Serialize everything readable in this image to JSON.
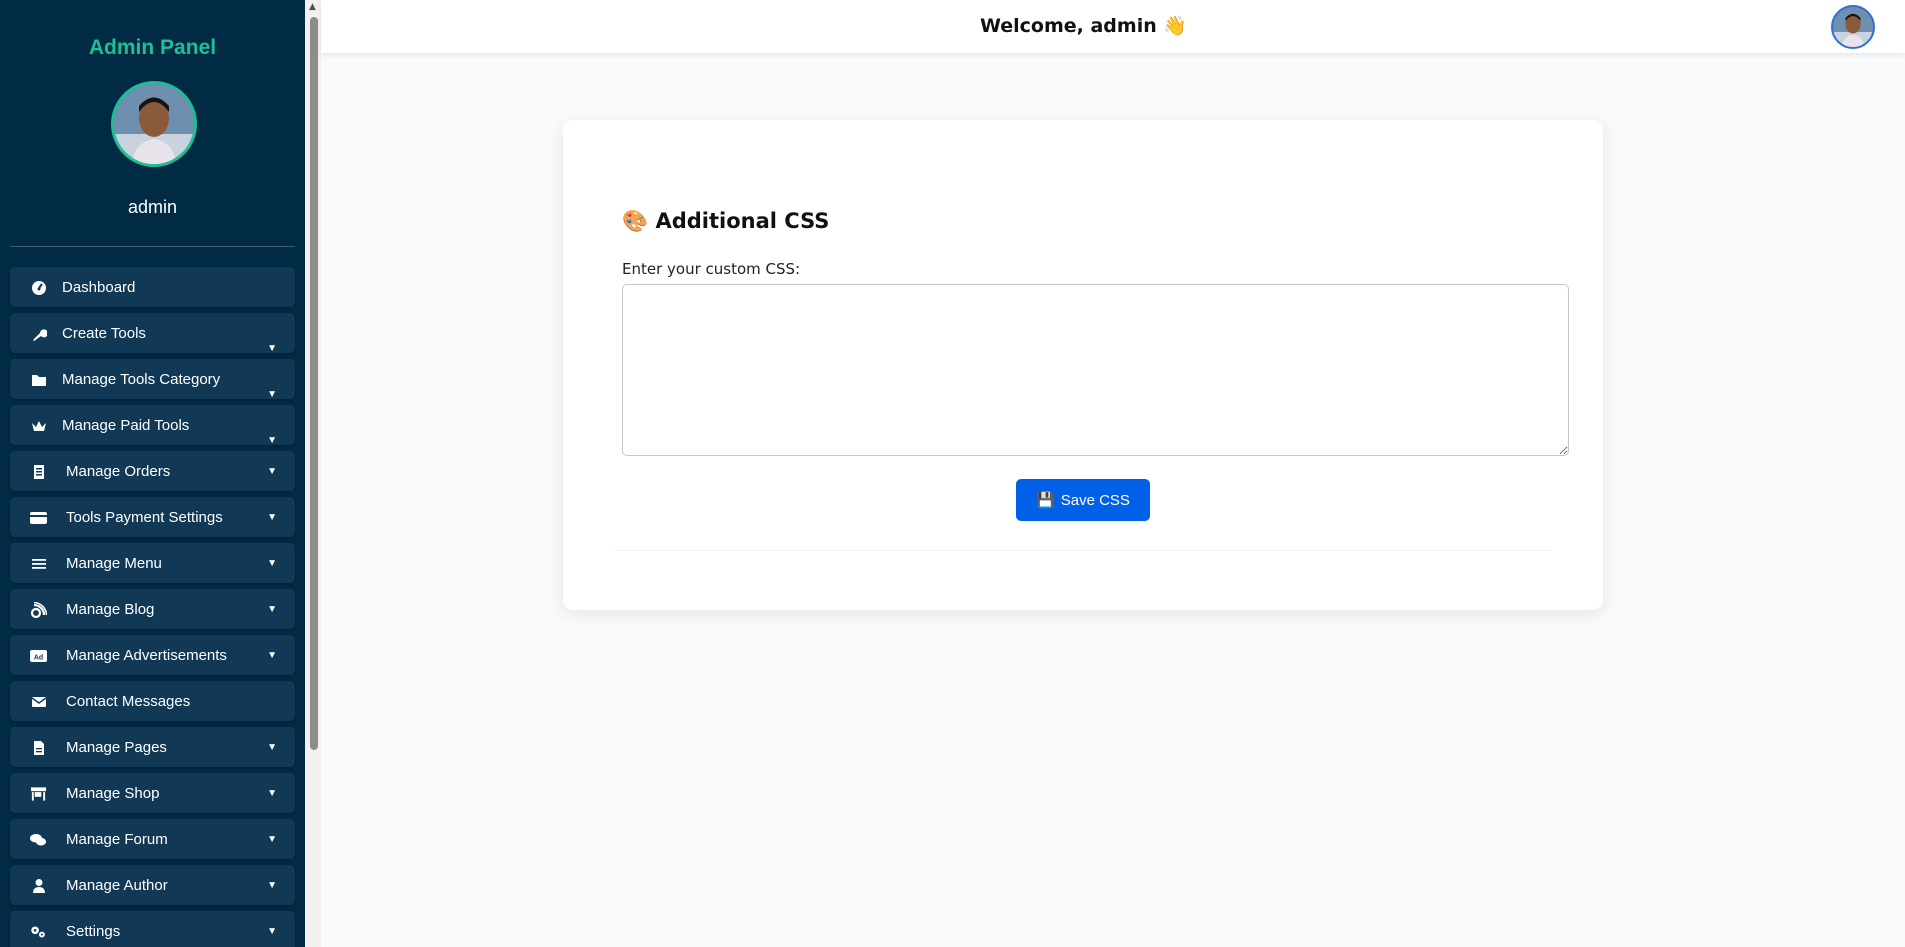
{
  "sidebar": {
    "brand": "Admin Panel",
    "username": "admin",
    "items": [
      {
        "label": "Dashboard",
        "icon": "dashboard-icon",
        "arrow": ""
      },
      {
        "label": "Create Tools",
        "icon": "wrench-icon",
        "arrow": "▼"
      },
      {
        "label": "Manage Tools Category",
        "icon": "folder-icon",
        "arrow": "▼"
      },
      {
        "label": "Manage Paid Tools",
        "icon": "crown-icon",
        "arrow": "▼"
      },
      {
        "label": "Manage Orders",
        "icon": "receipt-icon",
        "arrow": "▼"
      },
      {
        "label": "Tools Payment Settings",
        "icon": "credit-card-icon",
        "arrow": "▼"
      },
      {
        "label": "Manage Menu",
        "icon": "menu-icon",
        "arrow": "▼"
      },
      {
        "label": "Manage Blog",
        "icon": "blog-icon",
        "arrow": "▼"
      },
      {
        "label": "Manage Advertisements",
        "icon": "ad-icon",
        "arrow": "▼"
      },
      {
        "label": "Contact Messages",
        "icon": "envelope-icon",
        "arrow": ""
      },
      {
        "label": "Manage Pages",
        "icon": "file-icon",
        "arrow": "▼"
      },
      {
        "label": "Manage Shop",
        "icon": "store-icon",
        "arrow": "▼"
      },
      {
        "label": "Manage Forum",
        "icon": "comments-icon",
        "arrow": "▼"
      },
      {
        "label": "Manage Author",
        "icon": "user-icon",
        "arrow": "▼"
      },
      {
        "label": "Settings",
        "icon": "gears-icon",
        "arrow": "▼"
      }
    ]
  },
  "header": {
    "welcome": "Welcome, admin 👋"
  },
  "main": {
    "title": "🎨 Additional CSS",
    "field_label": "Enter your custom CSS:",
    "css_value": "",
    "save_icon": "💾",
    "save_label": "Save CSS"
  },
  "colors": {
    "sidebar_bg": "#012a44",
    "nav_item_bg": "#113955",
    "brand": "#1fbf94",
    "primary_button": "#0061e8"
  }
}
